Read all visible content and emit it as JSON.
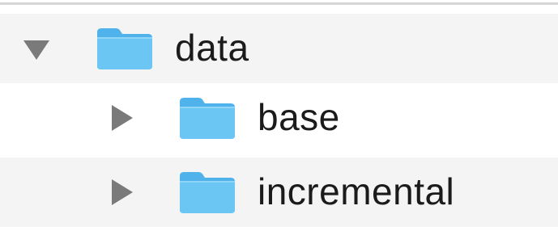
{
  "tree": {
    "rows": [
      {
        "label": "data",
        "expanded": true,
        "icon": "folder-icon"
      },
      {
        "label": "base",
        "expanded": false,
        "icon": "folder-icon"
      },
      {
        "label": "incremental",
        "expanded": false,
        "icon": "folder-icon"
      }
    ]
  },
  "colors": {
    "folder": "#62bff0",
    "disclosure": "#7a7a7a",
    "alternate_row": "#f4f4f4",
    "text": "#1b1b1b"
  }
}
